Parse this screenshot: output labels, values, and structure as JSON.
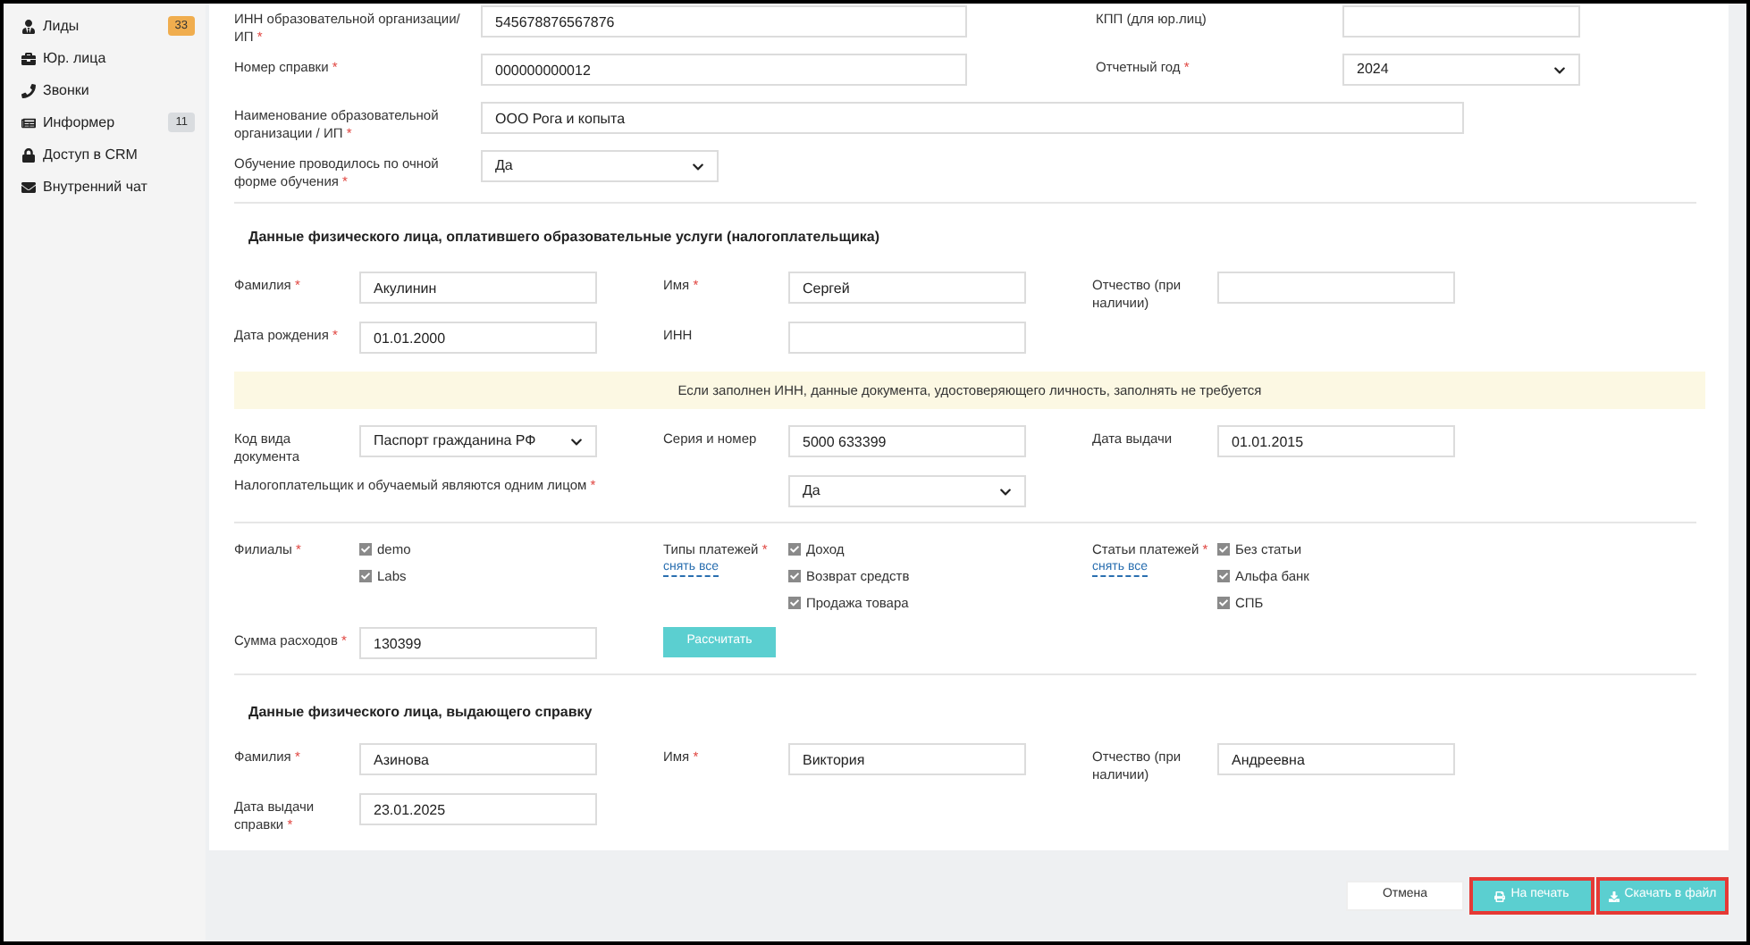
{
  "sidebar": {
    "items": [
      {
        "label": "Лиды",
        "badge": "33",
        "color": "#f0ad4e"
      },
      {
        "label": "Юр. лица"
      },
      {
        "label": "Звонки"
      },
      {
        "label": "Информер",
        "badge": "11",
        "color": "#d9dcdf"
      },
      {
        "label": "Доступ в CRM"
      },
      {
        "label": "Внутренний чат"
      }
    ]
  },
  "organization": {
    "rows": [
      [
        {
          "label": "ИНН образовательной организации/ИП",
          "required_mark": "*",
          "kind": "input",
          "value": "545678876567876"
        },
        {
          "label": "КПП (для юр.лиц)",
          "kind": "input"
        }
      ],
      [
        {
          "label": "Номер справки",
          "required_mark": "*",
          "kind": "input",
          "value": "000000000012"
        },
        {
          "label": "Отчетный год",
          "required_mark": "*",
          "kind": "select",
          "value": "2024"
        }
      ],
      [
        {
          "label": "Наименование образовательной организации / ИП",
          "required_mark": "*",
          "kind": "input",
          "value": "ООО Рога и копыта"
        }
      ],
      [
        {
          "label": "Обучение проводилось по очной форме обучения",
          "required_mark": "*",
          "kind": "select",
          "value": "Да"
        }
      ]
    ]
  },
  "payer": {
    "title": "Данные физического лица, оплатившего образовательные услуги (налогоплательщика)",
    "rows": [
      [
        {
          "label": "Фамилия",
          "required_mark": "*",
          "kind": "input",
          "value": "Акулинин"
        },
        {
          "label": "Имя",
          "required_mark": "*",
          "kind": "input",
          "value": "Сергей"
        },
        {
          "label": "Отчество (при наличии)",
          "kind": "input"
        }
      ],
      [
        {
          "label": "Дата рождения",
          "required_mark": "*",
          "kind": "input",
          "value": "01.01.2000"
        },
        {
          "label": "ИНН",
          "kind": "input"
        }
      ]
    ],
    "notice": "Если заполнен ИНН, данные документа, удостоверяющего личность, заполнять не требуется",
    "doc_rows": [
      [
        {
          "label": "Код вида документа",
          "kind": "select",
          "value": "Паспорт гражданина РФ"
        },
        {
          "label": "Серия и номер",
          "kind": "input",
          "value": "5000 633399"
        },
        {
          "label": "Дата выдачи",
          "kind": "input",
          "value": "01.01.2015"
        }
      ]
    ],
    "same_person": {
      "label": "Налогоплательщик и обучаемый являются одним лицом",
      "required_mark": "*",
      "value": "Да"
    },
    "check_groups": [
      {
        "label": "Филиалы",
        "required_mark": "*",
        "options": [
          {
            "label": "demo",
            "checked": true
          },
          {
            "label": "Labs",
            "checked": true
          }
        ]
      },
      {
        "label": "Типы платежей",
        "required_mark": "*",
        "link": "снять все",
        "options": [
          {
            "label": "Доход",
            "checked": true
          },
          {
            "label": "Возврат средств",
            "checked": true
          },
          {
            "label": "Продажа товара",
            "checked": true
          }
        ]
      },
      {
        "label": "Статьи платежей",
        "required_mark": "*",
        "link": "снять все",
        "options": [
          {
            "label": "Без статьи",
            "checked": true
          },
          {
            "label": "Альфа банк",
            "checked": true
          },
          {
            "label": "СПБ",
            "checked": true
          }
        ]
      }
    ],
    "expenses": {
      "label": "Сумма расходов",
      "required_mark": "*",
      "value": "130399"
    },
    "calculate_button": "Рассчитать"
  },
  "issuer": {
    "title": "Данные физического лица, выдающего справку",
    "rows": [
      [
        {
          "label": "Фамилия",
          "required_mark": "*",
          "kind": "input",
          "value": "Азинова"
        },
        {
          "label": "Имя",
          "required_mark": "*",
          "kind": "input",
          "value": "Виктория"
        },
        {
          "label": "Отчество (при наличии)",
          "kind": "input",
          "value": "Андреевна"
        }
      ],
      [
        {
          "label": "Дата выдачи справки",
          "required_mark": "*",
          "kind": "input",
          "value": "23.01.2025"
        }
      ]
    ]
  },
  "footer": {
    "buttons": [
      {
        "label": "Отмена",
        "highlighted": false
      },
      {
        "label": "На печать",
        "highlighted": true
      },
      {
        "label": "Скачать в файл",
        "highlighted": true
      }
    ]
  }
}
